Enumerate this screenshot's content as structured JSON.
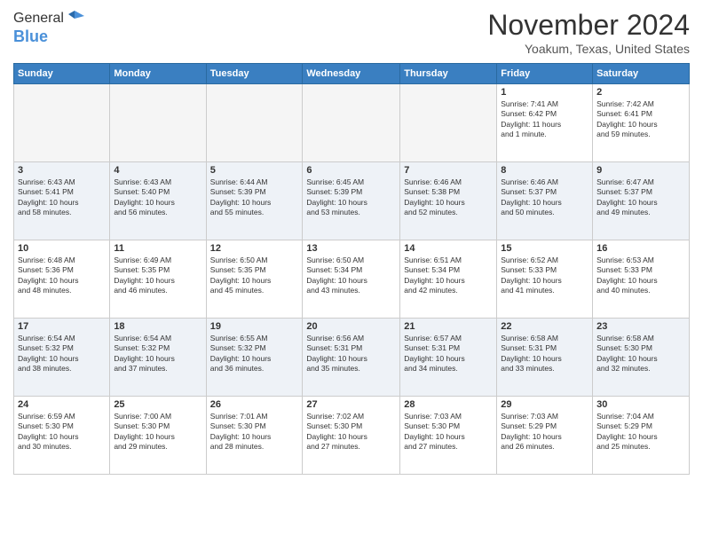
{
  "header": {
    "logo_general": "General",
    "logo_blue": "Blue",
    "month_title": "November 2024",
    "location": "Yoakum, Texas, United States"
  },
  "weekdays": [
    "Sunday",
    "Monday",
    "Tuesday",
    "Wednesday",
    "Thursday",
    "Friday",
    "Saturday"
  ],
  "weeks": [
    [
      {
        "day": "",
        "info": ""
      },
      {
        "day": "",
        "info": ""
      },
      {
        "day": "",
        "info": ""
      },
      {
        "day": "",
        "info": ""
      },
      {
        "day": "",
        "info": ""
      },
      {
        "day": "1",
        "info": "Sunrise: 7:41 AM\nSunset: 6:42 PM\nDaylight: 11 hours\nand 1 minute."
      },
      {
        "day": "2",
        "info": "Sunrise: 7:42 AM\nSunset: 6:41 PM\nDaylight: 10 hours\nand 59 minutes."
      }
    ],
    [
      {
        "day": "3",
        "info": "Sunrise: 6:43 AM\nSunset: 5:41 PM\nDaylight: 10 hours\nand 58 minutes."
      },
      {
        "day": "4",
        "info": "Sunrise: 6:43 AM\nSunset: 5:40 PM\nDaylight: 10 hours\nand 56 minutes."
      },
      {
        "day": "5",
        "info": "Sunrise: 6:44 AM\nSunset: 5:39 PM\nDaylight: 10 hours\nand 55 minutes."
      },
      {
        "day": "6",
        "info": "Sunrise: 6:45 AM\nSunset: 5:39 PM\nDaylight: 10 hours\nand 53 minutes."
      },
      {
        "day": "7",
        "info": "Sunrise: 6:46 AM\nSunset: 5:38 PM\nDaylight: 10 hours\nand 52 minutes."
      },
      {
        "day": "8",
        "info": "Sunrise: 6:46 AM\nSunset: 5:37 PM\nDaylight: 10 hours\nand 50 minutes."
      },
      {
        "day": "9",
        "info": "Sunrise: 6:47 AM\nSunset: 5:37 PM\nDaylight: 10 hours\nand 49 minutes."
      }
    ],
    [
      {
        "day": "10",
        "info": "Sunrise: 6:48 AM\nSunset: 5:36 PM\nDaylight: 10 hours\nand 48 minutes."
      },
      {
        "day": "11",
        "info": "Sunrise: 6:49 AM\nSunset: 5:35 PM\nDaylight: 10 hours\nand 46 minutes."
      },
      {
        "day": "12",
        "info": "Sunrise: 6:50 AM\nSunset: 5:35 PM\nDaylight: 10 hours\nand 45 minutes."
      },
      {
        "day": "13",
        "info": "Sunrise: 6:50 AM\nSunset: 5:34 PM\nDaylight: 10 hours\nand 43 minutes."
      },
      {
        "day": "14",
        "info": "Sunrise: 6:51 AM\nSunset: 5:34 PM\nDaylight: 10 hours\nand 42 minutes."
      },
      {
        "day": "15",
        "info": "Sunrise: 6:52 AM\nSunset: 5:33 PM\nDaylight: 10 hours\nand 41 minutes."
      },
      {
        "day": "16",
        "info": "Sunrise: 6:53 AM\nSunset: 5:33 PM\nDaylight: 10 hours\nand 40 minutes."
      }
    ],
    [
      {
        "day": "17",
        "info": "Sunrise: 6:54 AM\nSunset: 5:32 PM\nDaylight: 10 hours\nand 38 minutes."
      },
      {
        "day": "18",
        "info": "Sunrise: 6:54 AM\nSunset: 5:32 PM\nDaylight: 10 hours\nand 37 minutes."
      },
      {
        "day": "19",
        "info": "Sunrise: 6:55 AM\nSunset: 5:32 PM\nDaylight: 10 hours\nand 36 minutes."
      },
      {
        "day": "20",
        "info": "Sunrise: 6:56 AM\nSunset: 5:31 PM\nDaylight: 10 hours\nand 35 minutes."
      },
      {
        "day": "21",
        "info": "Sunrise: 6:57 AM\nSunset: 5:31 PM\nDaylight: 10 hours\nand 34 minutes."
      },
      {
        "day": "22",
        "info": "Sunrise: 6:58 AM\nSunset: 5:31 PM\nDaylight: 10 hours\nand 33 minutes."
      },
      {
        "day": "23",
        "info": "Sunrise: 6:58 AM\nSunset: 5:30 PM\nDaylight: 10 hours\nand 32 minutes."
      }
    ],
    [
      {
        "day": "24",
        "info": "Sunrise: 6:59 AM\nSunset: 5:30 PM\nDaylight: 10 hours\nand 30 minutes."
      },
      {
        "day": "25",
        "info": "Sunrise: 7:00 AM\nSunset: 5:30 PM\nDaylight: 10 hours\nand 29 minutes."
      },
      {
        "day": "26",
        "info": "Sunrise: 7:01 AM\nSunset: 5:30 PM\nDaylight: 10 hours\nand 28 minutes."
      },
      {
        "day": "27",
        "info": "Sunrise: 7:02 AM\nSunset: 5:30 PM\nDaylight: 10 hours\nand 27 minutes."
      },
      {
        "day": "28",
        "info": "Sunrise: 7:03 AM\nSunset: 5:30 PM\nDaylight: 10 hours\nand 27 minutes."
      },
      {
        "day": "29",
        "info": "Sunrise: 7:03 AM\nSunset: 5:29 PM\nDaylight: 10 hours\nand 26 minutes."
      },
      {
        "day": "30",
        "info": "Sunrise: 7:04 AM\nSunset: 5:29 PM\nDaylight: 10 hours\nand 25 minutes."
      }
    ]
  ]
}
